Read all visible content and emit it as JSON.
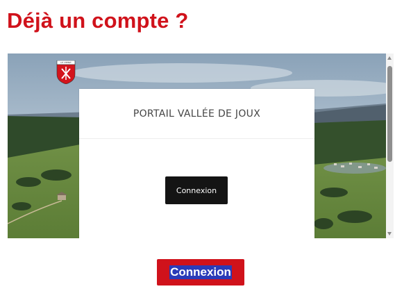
{
  "page": {
    "title": "Déjà un compte ?",
    "accent_color": "#d0121b"
  },
  "embed": {
    "crest_icon": "municipal-crest-icon",
    "crest_text": "LE CHENIT",
    "portal_title": "PORTAIL VALLÉE DE JOUX",
    "portal_login_label": "Connexion",
    "background": "aerial-landscape-photo"
  },
  "main": {
    "login_label": "Connexion",
    "login_color": "#d0121b"
  }
}
